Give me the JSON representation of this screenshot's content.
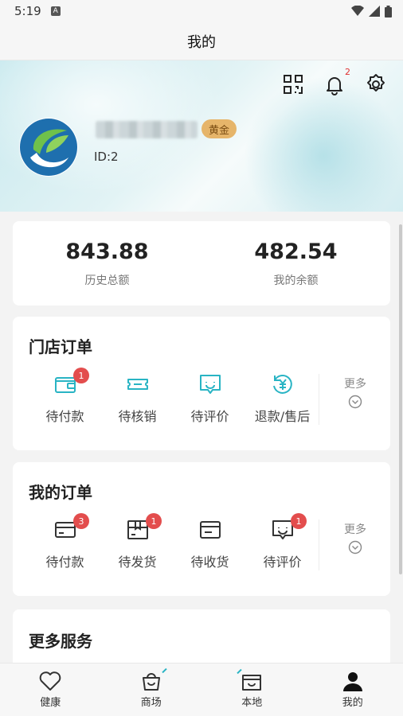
{
  "status_bar": {
    "time": "5:19",
    "notif_letter": "A"
  },
  "title_bar": {
    "title": "我的"
  },
  "header": {
    "notification_count": "2",
    "level_badge": "黄金",
    "user_id": "ID:2"
  },
  "stats": [
    {
      "value": "843.88",
      "label": "历史总额"
    },
    {
      "value": "482.54",
      "label": "我的余额"
    }
  ],
  "store_orders": {
    "title": "门店订单",
    "items": [
      {
        "label": "待付款",
        "icon": "wallet-icon",
        "badge": "1"
      },
      {
        "label": "待核销",
        "icon": "ticket-icon",
        "badge": ""
      },
      {
        "label": "待评价",
        "icon": "smile-chat-icon",
        "badge": ""
      },
      {
        "label": "退款/售后",
        "icon": "refund-yen-icon",
        "badge": ""
      }
    ],
    "more": "更多"
  },
  "my_orders": {
    "title": "我的订单",
    "items": [
      {
        "label": "待付款",
        "icon": "card-icon",
        "badge": "3"
      },
      {
        "label": "待发货",
        "icon": "box-icon",
        "badge": "1"
      },
      {
        "label": "待收货",
        "icon": "card-receive-icon",
        "badge": ""
      },
      {
        "label": "待评价",
        "icon": "smile-chat-icon",
        "badge": "1"
      }
    ],
    "more": "更多"
  },
  "more_services": {
    "title": "更多服务"
  },
  "tabs": [
    {
      "label": "健康",
      "icon": "heart-icon"
    },
    {
      "label": "商场",
      "icon": "shopping-bag-icon"
    },
    {
      "label": "本地",
      "icon": "store-icon"
    },
    {
      "label": "我的",
      "icon": "person-icon",
      "active": true
    }
  ],
  "colors": {
    "accent": "#29b4c4",
    "badge": "#e34d4d",
    "gold": "#e6b56a"
  }
}
